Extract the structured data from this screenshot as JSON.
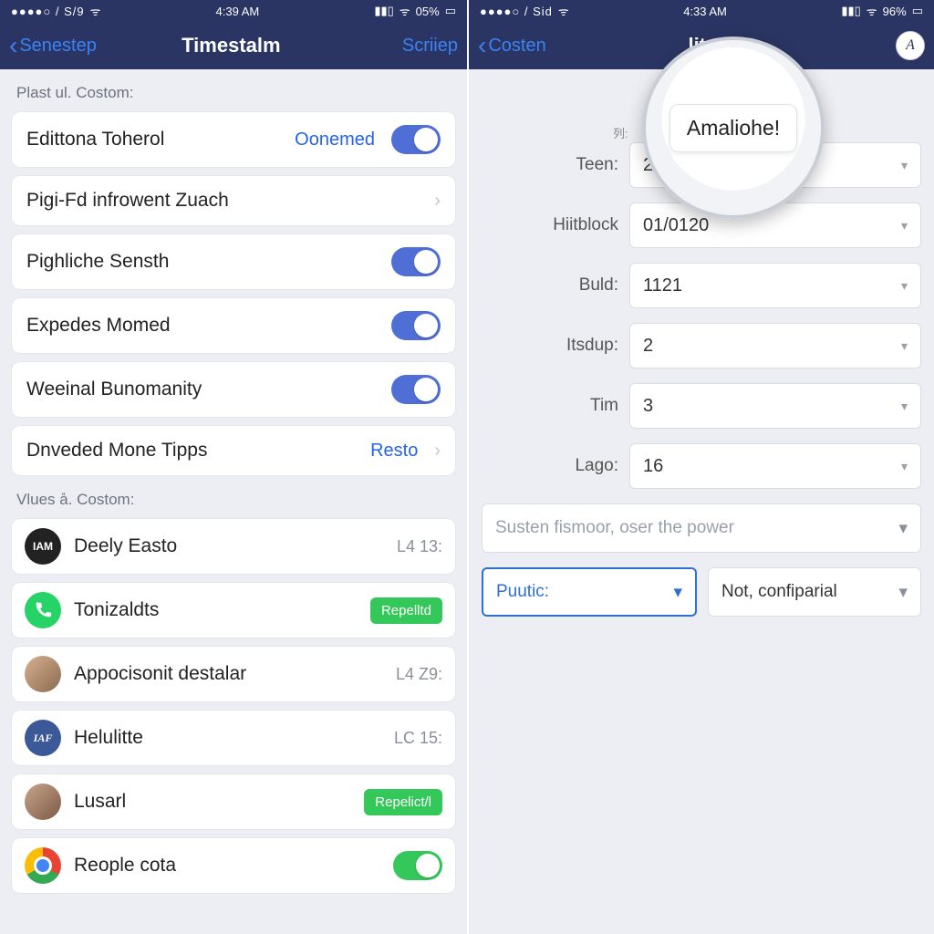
{
  "left": {
    "status": {
      "carrier": "●●●●○ / S/9",
      "time": "4:39 AM",
      "battery": "05%"
    },
    "nav": {
      "back": "Senestep",
      "title": "Timestalm",
      "action": "Scriiep"
    },
    "section1_header": "Plast ul. Costom:",
    "rows": [
      {
        "label": "Edittona Toherol",
        "value": "Oonemed",
        "type": "toggle-labeled"
      },
      {
        "label": "Pigi-Fd infrowent Zuach",
        "type": "nav"
      },
      {
        "label": "Pighliche Sensth",
        "type": "toggle"
      },
      {
        "label": "Expedes Momed",
        "type": "toggle"
      },
      {
        "label": "Weeinal Bunomanity",
        "type": "toggle"
      },
      {
        "label": "Dnveded Mone Tipps",
        "value": "Resto",
        "type": "nav-value"
      }
    ],
    "section2_header": "Vlues a̎. Costom:",
    "contacts": [
      {
        "name": "Deely Easto",
        "meta": "L4 13:",
        "avatar": "IAM",
        "cls": ""
      },
      {
        "name": "Tonizaldts",
        "pill": "Repelltd",
        "avatar": "",
        "cls": "green"
      },
      {
        "name": "Appocisonit destalar",
        "meta": "L4 Z9:",
        "avatar": "",
        "cls": "img1"
      },
      {
        "name": "Helulitte",
        "meta": "LC 15:",
        "avatar": "IAF",
        "cls": "blue"
      },
      {
        "name": "Lusarl",
        "pill": "Repelict/l",
        "avatar": "",
        "cls": "img2"
      },
      {
        "name": "Reople cota",
        "toggle": true,
        "avatar": "",
        "cls": "chrome"
      }
    ]
  },
  "right": {
    "status": {
      "carrier": "●●●●○ / Sid",
      "time": "4:33 AM",
      "battery": "96%"
    },
    "nav": {
      "back": "Costen",
      "title": "lite",
      "avatar": "A"
    },
    "magnifier": {
      "text": "Amaliohe!",
      "hint": "列:"
    },
    "fields": [
      {
        "label": "Teen:",
        "value": "25"
      },
      {
        "label": "Hiitblock",
        "value": "01/0120"
      },
      {
        "label": "Buld:",
        "value": "1121"
      },
      {
        "label": "Itsdup:",
        "value": "2"
      },
      {
        "label": "Tim",
        "value": "3"
      },
      {
        "label": "Lago:",
        "value": "16"
      }
    ],
    "wide1": "Susten fismoor, oser the power",
    "pair": {
      "a": "Puutic:",
      "b": "Not, confiparial"
    }
  }
}
